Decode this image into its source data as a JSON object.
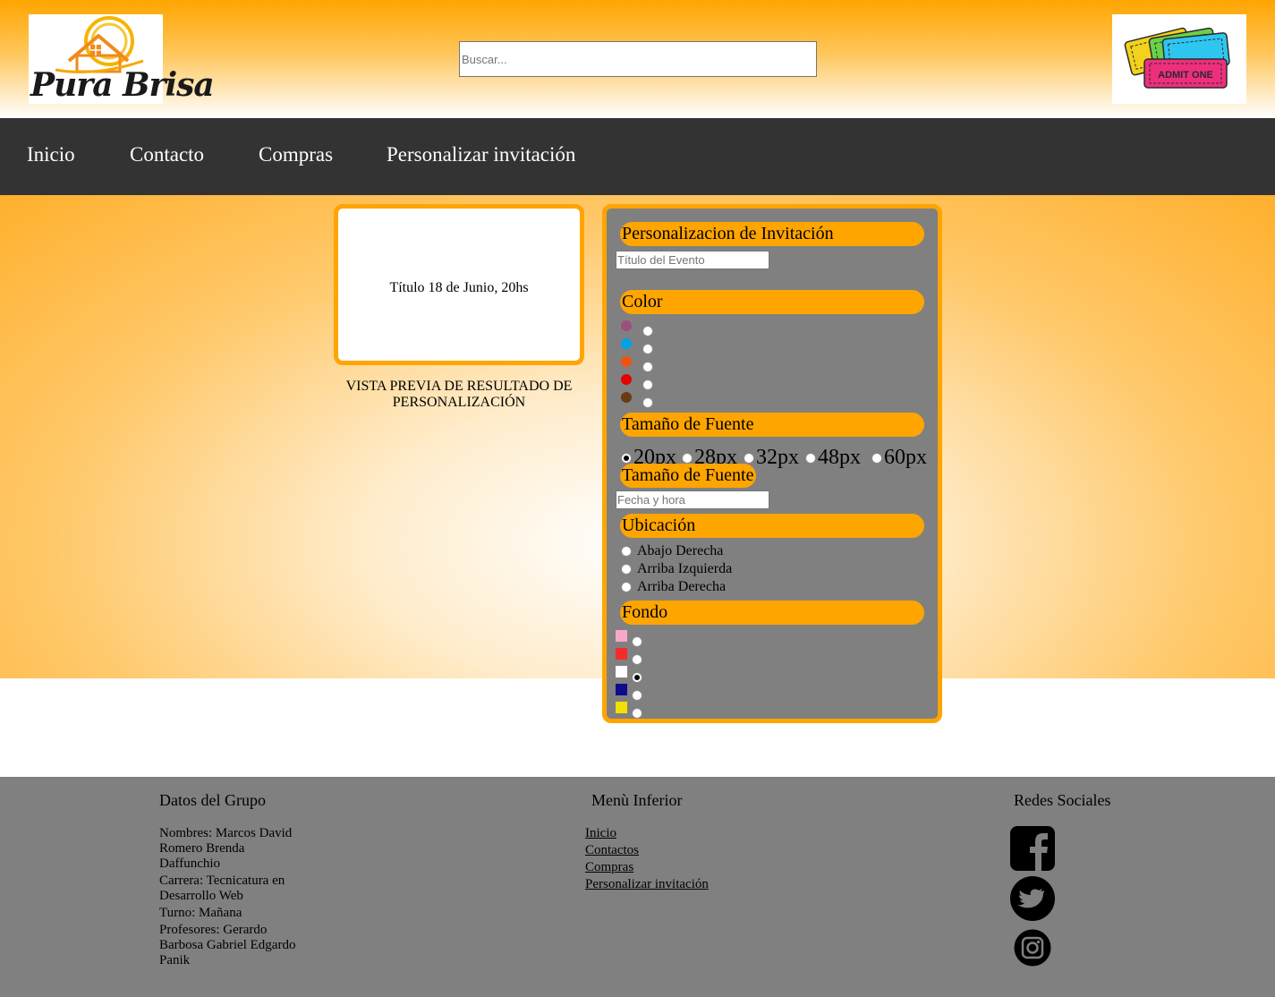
{
  "header": {
    "logo_text": "Pura Brisa",
    "search_placeholder": "Buscar...",
    "tickets_text": "ADMIT ONE"
  },
  "nav": {
    "items": [
      "Inicio",
      "Contacto",
      "Compras",
      "Personalizar invitación"
    ]
  },
  "preview": {
    "text": "Título 18 de Junio, 20hs",
    "caption": "VISTA PREVIA DE RESULTADO DE PERSONALIZACIÓN"
  },
  "panel": {
    "title_section": "Personalizacion de Invitación",
    "title_placeholder": "Título del Evento",
    "color_section": "Color",
    "colors": [
      "#9c4f7a",
      "#00a2e8",
      "#f0520f",
      "#e60000",
      "#6b3a13"
    ],
    "fontsize_section": "Tamaño de Fuente",
    "font_sizes": [
      "20px",
      "28px",
      "32px",
      "48px",
      "60px"
    ],
    "font_size_selected": "20px",
    "fontsize_section_2": "Tamaño de Fuente",
    "date_placeholder": "Fecha y hora",
    "location_section": "Ubicación",
    "locations": [
      "Abajo Derecha",
      "Arriba Izquierda",
      "Arriba Derecha"
    ],
    "background_section": "Fondo",
    "backgrounds": [
      "#f7a8c8",
      "#f52a2a",
      "#ffffff",
      "#0d0d8a",
      "#f2e100"
    ],
    "background_selected_index": 2
  },
  "footer": {
    "group_title": "Datos del Grupo",
    "names": "Nombres: Marcos David Romero Brenda Daffunchio",
    "career": "Carrera: Tecnicatura en Desarrollo Web",
    "shift": "Turno: Mañana",
    "teachers": "Profesores: Gerardo Barbosa Gabriel Edgardo Panik",
    "menu_title": "Menù Inferior",
    "menu_links": [
      "Inicio",
      "Contactos",
      "Compras",
      "Personalizar invitación"
    ],
    "social_title": "Redes Sociales",
    "social_icons": [
      "facebook-icon",
      "twitter-icon",
      "instagram-icon"
    ]
  }
}
